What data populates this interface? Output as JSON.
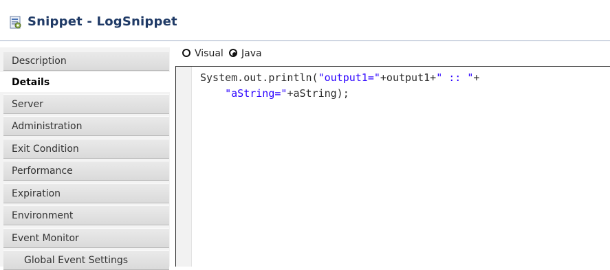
{
  "window": {
    "title": "Snippet - LogSnippet",
    "icon": "snippet-icon"
  },
  "sidebar": {
    "items": [
      {
        "label": "Description",
        "active": false
      },
      {
        "label": "Details",
        "active": true
      },
      {
        "label": "Server",
        "active": false
      },
      {
        "label": "Administration",
        "active": false
      },
      {
        "label": "Exit Condition",
        "active": false
      },
      {
        "label": "Performance",
        "active": false
      },
      {
        "label": "Expiration",
        "active": false
      },
      {
        "label": "Environment",
        "active": false
      },
      {
        "label": "Event Monitor",
        "active": false
      },
      {
        "label": "Global Event Settings",
        "active": false
      }
    ]
  },
  "editor_mode": {
    "options": [
      {
        "label": "Visual",
        "selected": false
      },
      {
        "label": "Java",
        "selected": true
      }
    ]
  },
  "code": {
    "line1": {
      "t1": "System.out.println(",
      "t2": "\"output1=\"",
      "t3": "+output1+",
      "t4": "\" :: \"",
      "t5": "+"
    },
    "line2": {
      "t1": "    ",
      "t2": "\"aString=\"",
      "t3": "+aString);"
    }
  },
  "colors": {
    "title": "#1f3a66",
    "code_string": "#2a00ff",
    "code_plain": "#2b2b2b",
    "active_tab": "#ffffff",
    "inactive_tab": "#dadada"
  }
}
